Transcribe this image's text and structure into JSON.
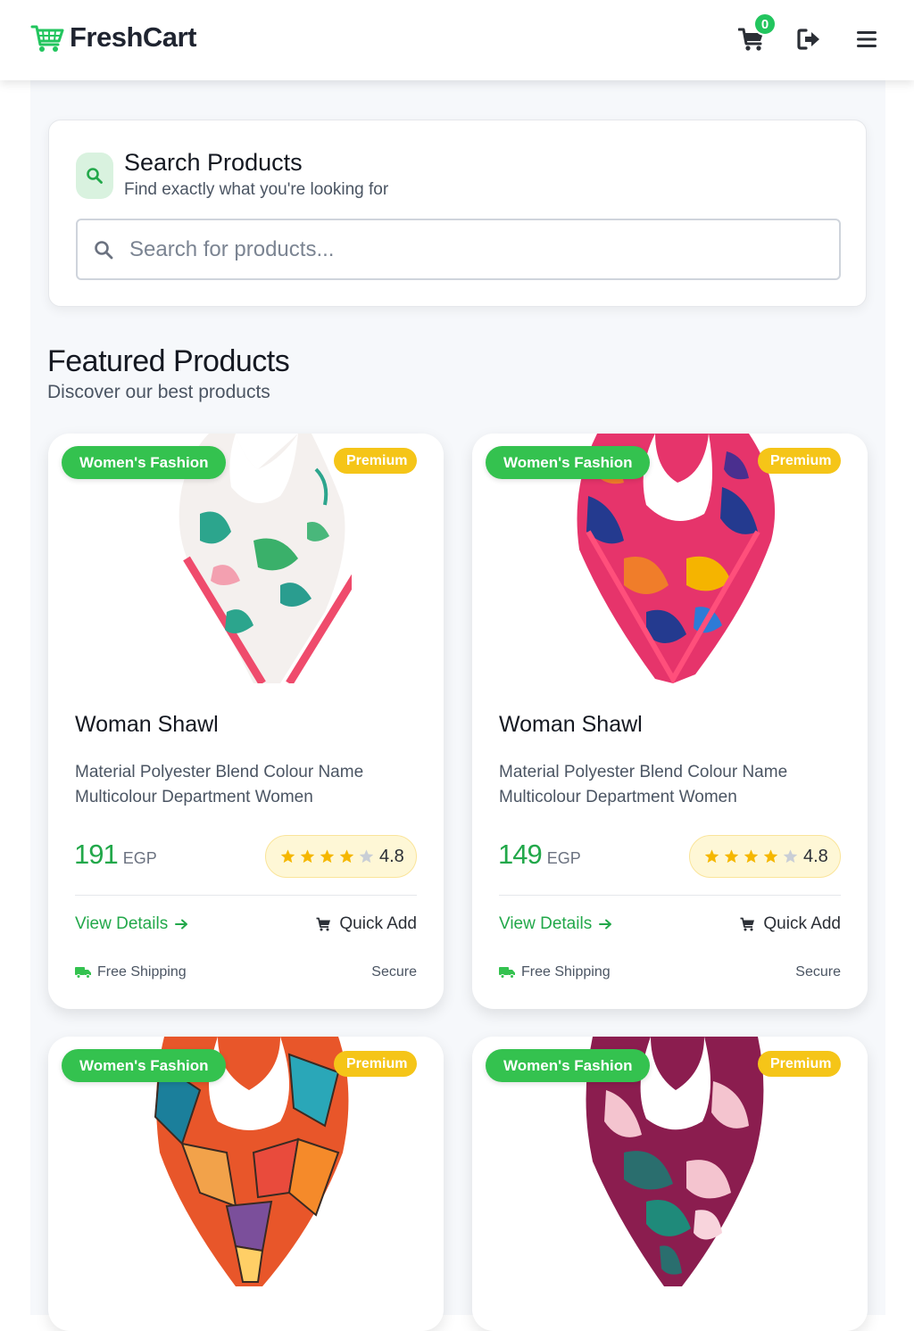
{
  "navbar": {
    "brand": "FreshCart",
    "cart_count": "0",
    "icons": [
      "cart-icon",
      "logout-icon",
      "menu-icon"
    ]
  },
  "search": {
    "title": "Search Products",
    "subtitle": "Find exactly what you're looking for",
    "placeholder": "Search for products...",
    "value": ""
  },
  "featured": {
    "title": "Featured Products",
    "subtitle": "Discover our best products"
  },
  "products": [
    {
      "category": "Women's Fashion",
      "badge": "Premium",
      "title": "Woman Shawl",
      "description": "Material Polyester Blend Colour Name Multicolour Department Women",
      "price": "191",
      "currency": "EGP",
      "rating": "4.8",
      "view_label": "View Details",
      "quick_add_label": "Quick Add",
      "shipping": "Free Shipping",
      "secure": "Secure"
    },
    {
      "category": "Women's Fashion",
      "badge": "Premium",
      "title": "Woman Shawl",
      "description": "Material Polyester Blend Colour Name Multicolour Department Women",
      "price": "149",
      "currency": "EGP",
      "rating": "4.8",
      "view_label": "View Details",
      "quick_add_label": "Quick Add",
      "shipping": "Free Shipping",
      "secure": "Secure"
    },
    {
      "category": "Women's Fashion",
      "badge": "Premium"
    },
    {
      "category": "Women's Fashion",
      "badge": "Premium"
    }
  ],
  "colors": {
    "brand_green": "#22c55e",
    "price_green": "#22a84a",
    "category_badge": "#34c24f",
    "premium_badge": "#f5c518",
    "star": "#f5b700"
  }
}
